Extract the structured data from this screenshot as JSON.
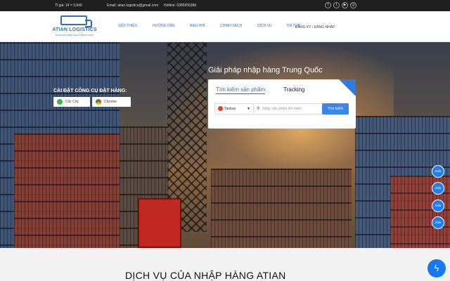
{
  "topbar": {
    "rate": "Tỉ giá: 1¥ = 3,840",
    "email": "Email: atian.logistics@gmail.com",
    "hotline": "Hotline: 0385555386",
    "social_icons": [
      "facebook-icon",
      "twitter-icon",
      "youtube-icon",
      "instagram-icon"
    ]
  },
  "logo": {
    "name": "ATIAN LOGISTICS",
    "tagline": "GIẢI PHÁP NHẬP HÀNG TRUNG QUỐC"
  },
  "nav": {
    "items": [
      "GIỚI THIỆU",
      "HƯỚNG DẪN",
      "BIỂU PHÍ",
      "CHÍNH SÁCH",
      "DỊCH VỤ",
      "TIN TỨC"
    ],
    "auth": "ĐĂNG KÝ / ĐĂNG NHẬP"
  },
  "install": {
    "title": "CÀI ĐẶT CÔNG CỤ ĐẶT HÀNG:",
    "buttons": [
      "Cốc Cốc",
      "Chrome"
    ]
  },
  "hero": {
    "title": "Giải pháp nhập hàng Trung Quốc"
  },
  "search": {
    "tabs": [
      "Tìm kiếm sản phẩm",
      "Tracking"
    ],
    "site": "Taobao",
    "placeholder": "Nhập sản phẩm tìm kiếm",
    "button": "Tìm kiếm"
  },
  "float": {
    "zalo": [
      "Zalo",
      "Zalo",
      "Zalo",
      "Zalo"
    ]
  },
  "section": {
    "title": "DỊCH VỤ CỦA NHẬP HÀNG ATIAN"
  },
  "colors": {
    "accent": "#2f6fc0",
    "button": "#3b86e8",
    "zalo": "#1f7ef2",
    "messenger": "#1877f2"
  }
}
